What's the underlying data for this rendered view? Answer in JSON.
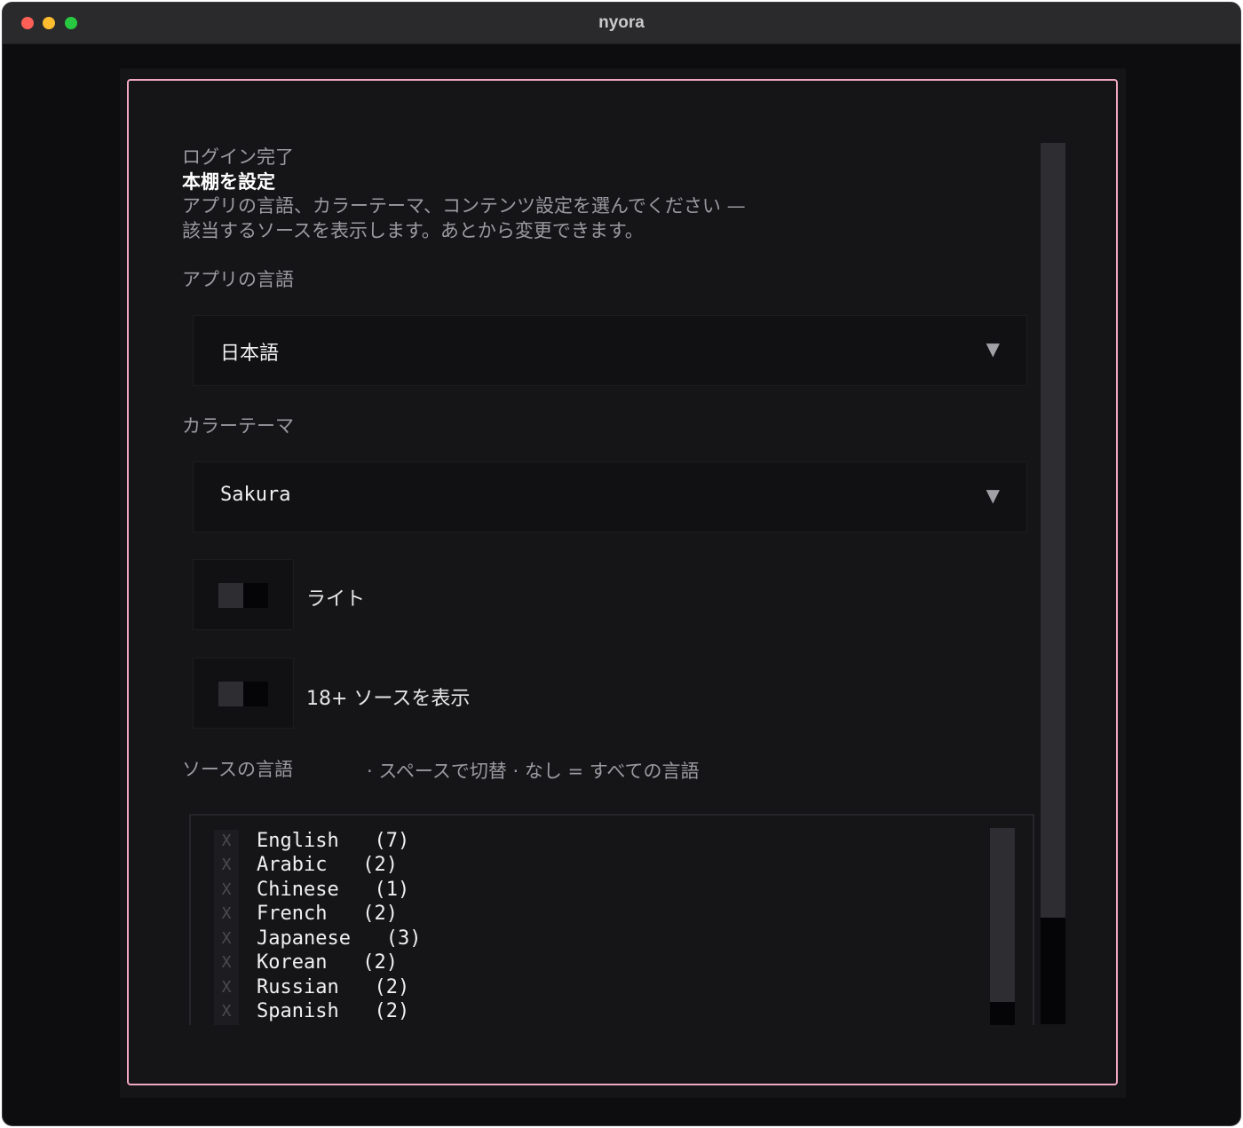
{
  "window": {
    "title": "nyora"
  },
  "onboarding": {
    "status": "ログイン完了",
    "heading": "本棚を設定",
    "description_line1": "アプリの言語、カラーテーマ、コンテンツ設定を選んでください —",
    "description_line2": "該当するソースを表示します。あとから変更できます。"
  },
  "app_language": {
    "label": "アプリの言語",
    "selected": "日本語",
    "arrow": "▼"
  },
  "color_theme": {
    "label": "カラーテーマ",
    "selected": "Sakura",
    "arrow": "▼"
  },
  "toggles": {
    "light": {
      "label": "ライト",
      "on": false
    },
    "nsfw": {
      "label": "18+ ソースを表示",
      "on": false
    }
  },
  "source_languages": {
    "label": "ソースの言語",
    "hint": "· スペースで切替 · なし = すべての言語",
    "checkbox_mark": "X",
    "items": [
      {
        "name": "English",
        "count": "(7)"
      },
      {
        "name": "Arabic",
        "count": "(2)"
      },
      {
        "name": "Chinese",
        "count": "(1)"
      },
      {
        "name": "French",
        "count": "(2)"
      },
      {
        "name": "Japanese",
        "count": "(3)"
      },
      {
        "name": "Korean",
        "count": "(2)"
      },
      {
        "name": "Russian",
        "count": "(2)"
      },
      {
        "name": "Spanish",
        "count": "(2)"
      }
    ]
  },
  "colors": {
    "accent_border": "#f0a8c0",
    "background": "#151518"
  }
}
